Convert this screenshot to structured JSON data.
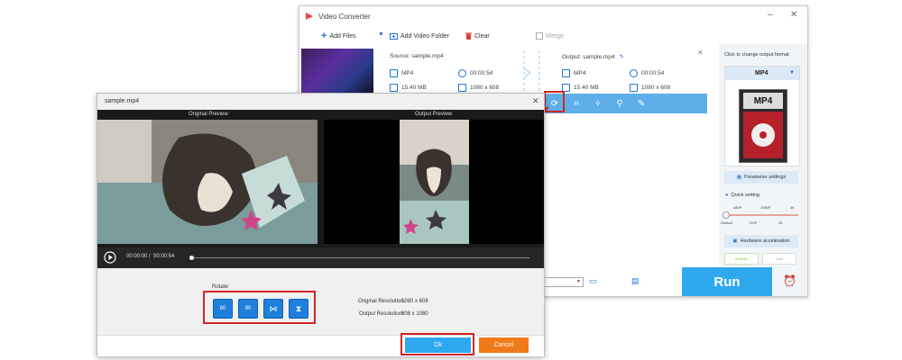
{
  "main_window": {
    "title": "Video Converter",
    "toolbar": {
      "add_files": "Add Files",
      "add_video_folder": "Add Video Folder",
      "clear": "Clear",
      "merge": "Merge"
    },
    "file": {
      "source_label": "Source: sample.mp4",
      "output_label": "Output: sample.mp4",
      "source_format": "MP4",
      "source_duration": "00:00:54",
      "source_size": "15.40 MB",
      "source_resolution": "1080 x 608",
      "output_format": "MP4",
      "output_duration": "00:00:54",
      "output_size": "15.40 MB",
      "output_resolution": "1080 x 608"
    },
    "side_panel": {
      "change_format_label": "Click to change output format:",
      "format_selected": "MP4",
      "format_tile_text": "MP4",
      "parameter_settings": "Parameter settings",
      "quick_setting": "Quick setting",
      "quality_top": [
        "480P",
        "1080P",
        "4K"
      ],
      "quality_bottom": [
        "Default",
        "720P",
        "2K"
      ],
      "hardware_acceleration": "Hardware acceleration",
      "gpu_nvidia": "NVIDIA",
      "gpu_intel": "Intel"
    },
    "run_label": "Run"
  },
  "dialog": {
    "title": "sample.mp4",
    "original_preview_label": "Original Preview",
    "output_preview_label": "Output Preview",
    "time_current": "00:00:00",
    "time_separator": "/",
    "time_total": "00:00:54",
    "rotate_label": "Rotate:",
    "rotate_buttons": [
      "90",
      "90",
      "",
      ""
    ],
    "original_resolution_label": "Original Resolution:",
    "original_resolution": "1080 x 608",
    "output_resolution_label": "Output Resolution:",
    "output_resolution": "608 x 1080",
    "ok_label": "Ok",
    "cancel_label": "Cancel"
  },
  "colors": {
    "accent_blue": "#2ea8ef",
    "highlight_red": "#d32424",
    "cancel_orange": "#f07a1a",
    "toolbar_blue": "#5daee9"
  }
}
